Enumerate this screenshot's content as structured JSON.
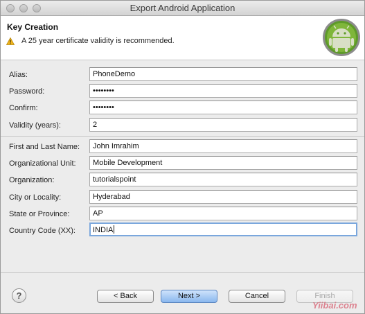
{
  "window": {
    "title": "Export Android Application"
  },
  "banner": {
    "title": "Key Creation",
    "warning_icon": "warning-triangle-icon",
    "warning_text": "A 25 year certificate validity is recommended.",
    "logo": "android-logo"
  },
  "form": {
    "alias": {
      "label": "Alias:",
      "value": "PhoneDemo"
    },
    "password": {
      "label": "Password:",
      "value": "••••••••"
    },
    "confirm": {
      "label": "Confirm:",
      "value": "••••••••"
    },
    "validity": {
      "label": "Validity (years):",
      "value": "2"
    },
    "name": {
      "label": "First and Last Name:",
      "value": "John Imrahim"
    },
    "org_unit": {
      "label": "Organizational Unit:",
      "value": "Mobile Development"
    },
    "organization": {
      "label": "Organization:",
      "value": "tutorialspoint"
    },
    "city": {
      "label": "City or Locality:",
      "value": "Hyderabad"
    },
    "state": {
      "label": "State or Province:",
      "value": "AP"
    },
    "country": {
      "label": "Country Code (XX):",
      "value": "INDIA"
    }
  },
  "footer": {
    "help_label": "?",
    "back_label": "< Back",
    "next_label": "Next >",
    "cancel_label": "Cancel",
    "finish_label": "Finish"
  },
  "watermark": "Yiibai.com",
  "colors": {
    "focus": "#7aa7dd",
    "primary_button": "#8ab7ee",
    "warning": "#f2b61c",
    "android_green": "#9fc43a"
  }
}
